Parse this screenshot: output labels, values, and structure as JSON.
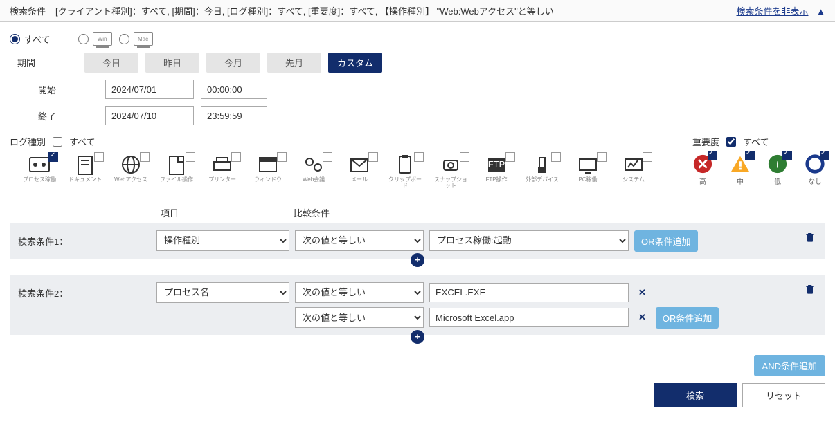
{
  "header": {
    "title": "検索条件",
    "summary": "[クライアント種別]：すべて, [期間]：今日, [ログ種別]：すべて, [重要度]：すべて, 【操作種別】 \"Web:Webアクセス\"と等しい",
    "hide_link": "検索条件を非表示"
  },
  "client": {
    "all": "すべて"
  },
  "period": {
    "label": "期間",
    "btns": [
      "今日",
      "昨日",
      "今月",
      "先月",
      "カスタム"
    ],
    "start_label": "開始",
    "end_label": "終了",
    "start_date": "2024/07/01",
    "start_time": "00:00:00",
    "end_date": "2024/07/10",
    "end_time": "23:59:59"
  },
  "log": {
    "label": "ログ種別",
    "all": "すべて",
    "cats": [
      "プロセス稼働",
      "ドキュメント",
      "Webアクセス",
      "ファイル操作",
      "プリンター",
      "ウィンドウ",
      "Web会議",
      "メール",
      "クリップボード",
      "スナップショット",
      "FTP操作",
      "外部デバイス",
      "PC稼働",
      "システム"
    ]
  },
  "severity": {
    "label": "重要度",
    "all": "すべて",
    "levels": [
      "高",
      "中",
      "低",
      "なし"
    ]
  },
  "cond": {
    "col_item": "項目",
    "col_op": "比較条件",
    "row1": "検索条件1：",
    "row2": "検索条件2：",
    "field1": "操作種別",
    "field2": "プロセス名",
    "op": "次の値と等しい",
    "val1": "プロセス稼働:起動",
    "val2a": "EXCEL.EXE",
    "val2b": "Microsoft Excel.app",
    "or": "OR条件追加",
    "and": "AND条件追加"
  },
  "actions": {
    "search": "検索",
    "reset": "リセット"
  }
}
